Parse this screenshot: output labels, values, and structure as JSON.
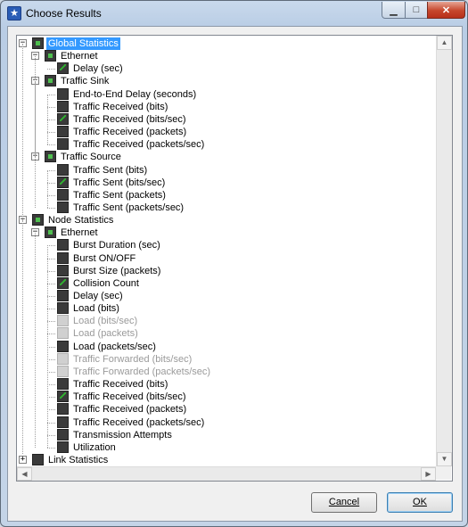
{
  "window": {
    "title": "Choose Results"
  },
  "title_controls": {
    "minimize": "▁",
    "maximize": "□",
    "close": "✕"
  },
  "tree": {
    "rows": [
      {
        "depth": 0,
        "toggle": "−",
        "check": "mixed",
        "label": "Global Statistics",
        "selected": true
      },
      {
        "depth": 1,
        "toggle": "−",
        "check": "mixed",
        "label": "Ethernet"
      },
      {
        "depth": 2,
        "check": "on",
        "label": "Delay (sec)"
      },
      {
        "depth": 1,
        "toggle": "−",
        "check": "mixed",
        "label": "Traffic Sink"
      },
      {
        "depth": 2,
        "check": "off",
        "label": "End-to-End Delay (seconds)"
      },
      {
        "depth": 2,
        "check": "off",
        "label": "Traffic Received (bits)"
      },
      {
        "depth": 2,
        "check": "on",
        "label": "Traffic Received (bits/sec)"
      },
      {
        "depth": 2,
        "check": "off",
        "label": "Traffic Received (packets)"
      },
      {
        "depth": 2,
        "check": "off",
        "label": "Traffic Received (packets/sec)"
      },
      {
        "depth": 1,
        "toggle": "−",
        "check": "mixed",
        "label": "Traffic Source"
      },
      {
        "depth": 2,
        "check": "off",
        "label": "Traffic Sent (bits)"
      },
      {
        "depth": 2,
        "check": "on",
        "label": "Traffic Sent (bits/sec)"
      },
      {
        "depth": 2,
        "check": "off",
        "label": "Traffic Sent (packets)"
      },
      {
        "depth": 2,
        "check": "off",
        "label": "Traffic Sent (packets/sec)"
      },
      {
        "depth": 0,
        "toggle": "−",
        "check": "mixed",
        "label": "Node Statistics"
      },
      {
        "depth": 1,
        "toggle": "−",
        "check": "mixed",
        "label": "Ethernet"
      },
      {
        "depth": 2,
        "check": "off",
        "label": "Burst Duration (sec)"
      },
      {
        "depth": 2,
        "check": "off",
        "label": "Burst ON/OFF"
      },
      {
        "depth": 2,
        "check": "off",
        "label": "Burst Size (packets)"
      },
      {
        "depth": 2,
        "check": "on",
        "label": "Collision Count"
      },
      {
        "depth": 2,
        "check": "off",
        "label": "Delay (sec)"
      },
      {
        "depth": 2,
        "check": "off",
        "label": "Load (bits)"
      },
      {
        "depth": 2,
        "check": "gray",
        "label": "Load (bits/sec)",
        "dim": true
      },
      {
        "depth": 2,
        "check": "gray",
        "label": "Load (packets)",
        "dim": true
      },
      {
        "depth": 2,
        "check": "off",
        "label": "Load (packets/sec)"
      },
      {
        "depth": 2,
        "check": "gray",
        "label": "Traffic Forwarded (bits/sec)",
        "dim": true
      },
      {
        "depth": 2,
        "check": "gray",
        "label": "Traffic Forwarded (packets/sec)",
        "dim": true
      },
      {
        "depth": 2,
        "check": "off",
        "label": "Traffic Received (bits)"
      },
      {
        "depth": 2,
        "check": "on",
        "label": "Traffic Received (bits/sec)"
      },
      {
        "depth": 2,
        "check": "off",
        "label": "Traffic Received (packets)"
      },
      {
        "depth": 2,
        "check": "off",
        "label": "Traffic Received (packets/sec)"
      },
      {
        "depth": 2,
        "check": "off",
        "label": "Transmission Attempts"
      },
      {
        "depth": 2,
        "check": "off",
        "label": "Utilization"
      },
      {
        "depth": 0,
        "toggle": "+",
        "check": "off",
        "label": "Link Statistics"
      }
    ]
  },
  "scroll": {
    "up": "▲",
    "down": "▼",
    "left": "◀",
    "right": "▶"
  },
  "buttons": {
    "cancel": "Cancel",
    "ok": "OK"
  }
}
